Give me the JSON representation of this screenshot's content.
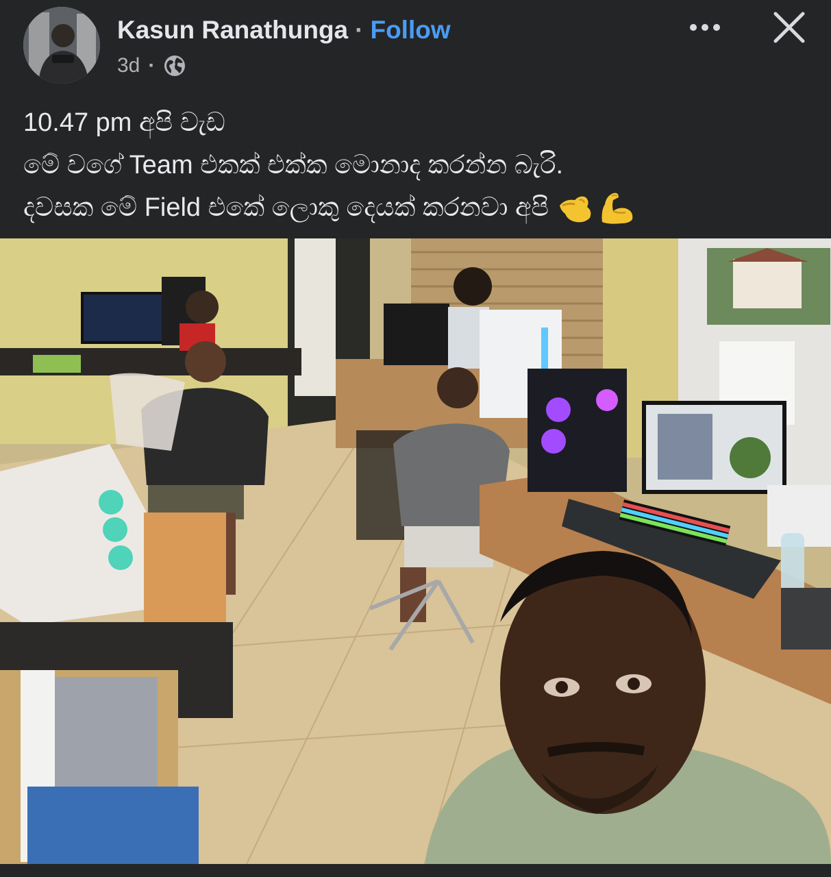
{
  "post": {
    "author_name": "Kasun Ranathunga",
    "separator": "·",
    "follow_label": "Follow",
    "timestamp": "3d",
    "meta_separator": "·",
    "privacy_icon": "globe-icon",
    "lines": [
      "10.47 pm අපි වැඩ",
      "මේ වගේ Team එකක් එක්ක මොනාද කරන්න බැරි.",
      "දවසක මේ Field එකේ ලොකු දෙයක් කරනවා අපි"
    ],
    "emojis": [
      "flexed-biceps-left-emoji",
      "flexed-biceps-right-emoji"
    ]
  },
  "controls": {
    "more_icon": "more-options-icon",
    "close_icon": "close-icon"
  },
  "colors": {
    "background": "#242526",
    "text_primary": "#e4e6eb",
    "text_secondary": "#b0b3b8",
    "link_blue": "#4a9cf5",
    "emoji_yellow": "#f4c430"
  },
  "photo": {
    "description_icon": "post-photo"
  }
}
